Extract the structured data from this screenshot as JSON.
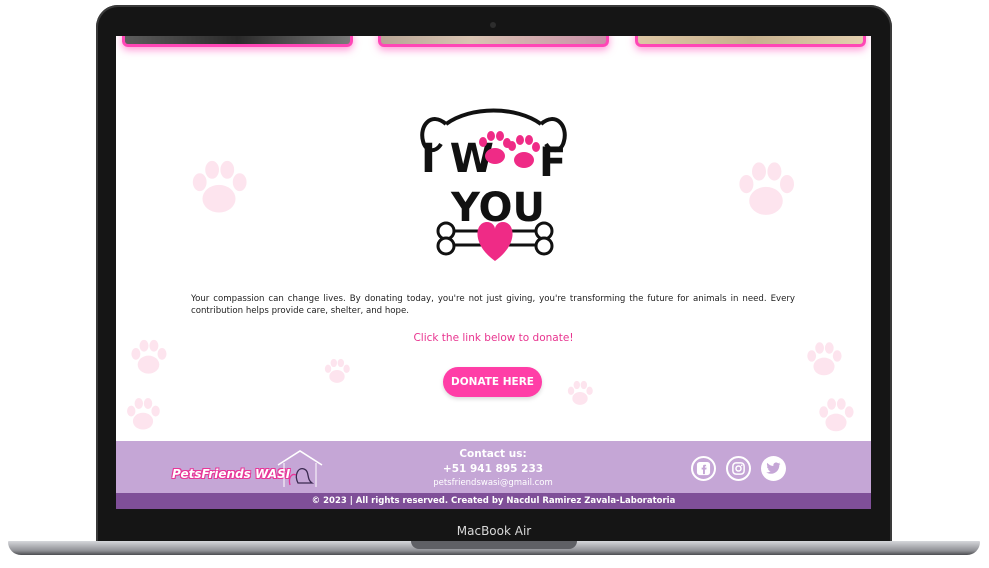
{
  "device": {
    "label": "MacBook Air"
  },
  "hero": {
    "logo_text_line1": "I W",
    "logo_text_line1_end": "F",
    "logo_text_line2": "YOU"
  },
  "message": {
    "body": "Your compassion can change lives. By donating today, you're not just giving, you're transforming the future for animals in need. Every contribution helps provide care, shelter, and hope.",
    "prompt": "Click the link below to donate!",
    "button_label": "DONATE HERE"
  },
  "footer": {
    "brand": "PetsFriends WASI",
    "contact_title": "Contact us:",
    "phone": "+51 941 895 233",
    "email": "petsfriendswasi@gmail.com",
    "social": [
      "facebook-icon",
      "instagram-icon",
      "twitter-icon"
    ],
    "copyright": "© 2023 | All rights reserved. Created by Nacdul Ramirez Zavala-Laboratoria"
  },
  "colors": {
    "accent_pink": "#ff3ea7",
    "footer_purple": "#c5a6d6",
    "copyright_purple": "#7f4f98"
  }
}
